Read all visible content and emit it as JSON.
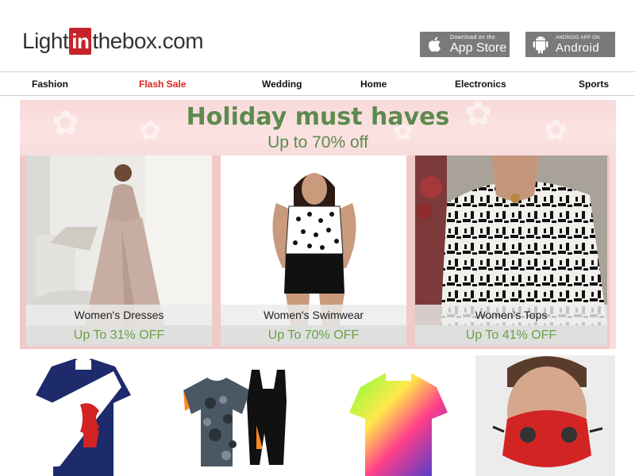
{
  "logo": {
    "part1": "Light",
    "part2": "in",
    "part3": "thebox",
    "part4": ".com"
  },
  "apps": {
    "ios": {
      "small": "Download on the",
      "big": "App Store",
      "icon": "apple-icon"
    },
    "android": {
      "small": "ANDROID APP ON",
      "big": "Android",
      "icon": "android-icon"
    }
  },
  "nav": {
    "items": [
      {
        "label": "Fashion"
      },
      {
        "label": "Flash Sale",
        "color": "#e02020"
      },
      {
        "label": "Wedding"
      },
      {
        "label": "Home"
      },
      {
        "label": "Electronics"
      },
      {
        "label": "Sports"
      }
    ]
  },
  "banner": {
    "title": "Holiday must haves",
    "subtitle": "Up to 70% off",
    "cards": [
      {
        "label": "Women's Dresses",
        "offer": "Up To 31% OFF"
      },
      {
        "label": "Women's Swimwear",
        "offer": "Up To 70% OFF"
      },
      {
        "label": "Women's Tops",
        "offer": "Up To 41% OFF"
      }
    ]
  },
  "products": [
    {
      "name": "scotland-cycling-jersey"
    },
    {
      "name": "camo-cycling-kit"
    },
    {
      "name": "neon-cycling-jersey"
    },
    {
      "name": "sports-face-mask"
    }
  ],
  "colors": {
    "accent": "#c8232c",
    "flash": "#e02020",
    "promo_green": "#5d8a4e",
    "offer_green": "#6aa046"
  }
}
